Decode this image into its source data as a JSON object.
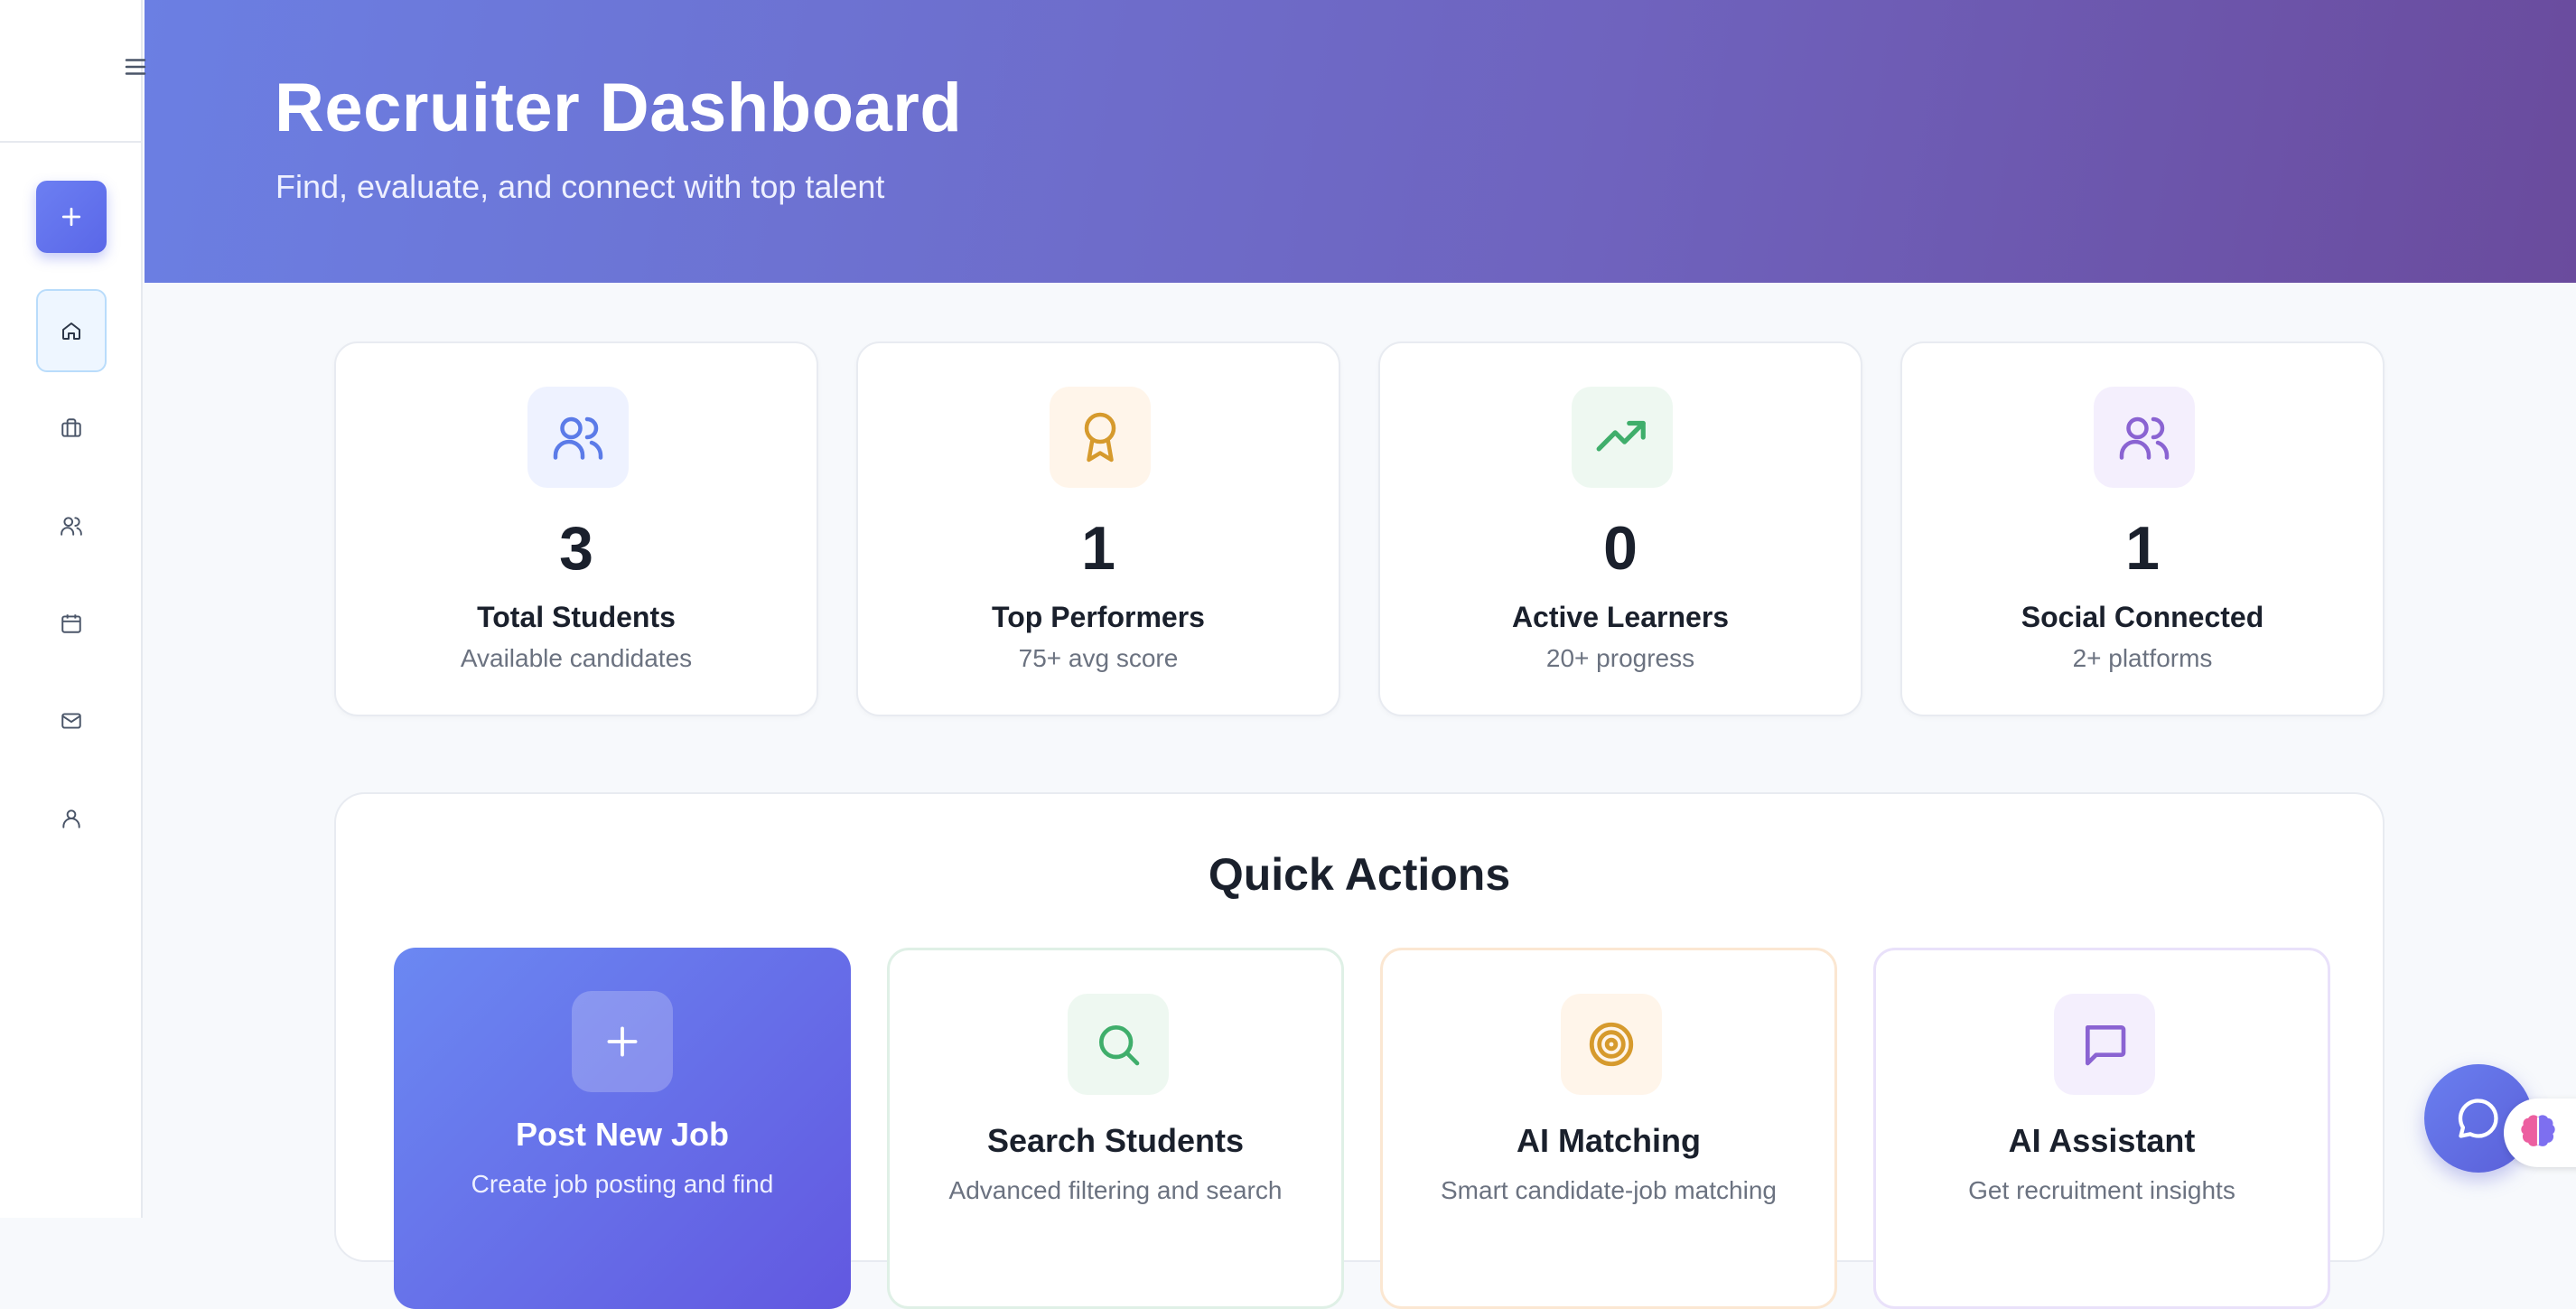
{
  "header": {
    "title": "Recruiter Dashboard",
    "subtitle": "Find, evaluate, and connect with top talent"
  },
  "sidebar": {
    "items": [
      {
        "icon": "home-icon",
        "active": true
      },
      {
        "icon": "briefcase-icon",
        "active": false
      },
      {
        "icon": "users-icon",
        "active": false
      },
      {
        "icon": "calendar-icon",
        "active": false
      },
      {
        "icon": "mail-icon",
        "active": false
      },
      {
        "icon": "user-icon",
        "active": false
      }
    ]
  },
  "stats": [
    {
      "value": "3",
      "title": "Total Students",
      "subtitle": "Available candidates",
      "icon": "users-icon",
      "color": "#5b7be8",
      "bg": "#eef2ff"
    },
    {
      "value": "1",
      "title": "Top Performers",
      "subtitle": "75+ avg score",
      "icon": "award-icon",
      "color": "#d69a2d",
      "bg": "#fff5ea"
    },
    {
      "value": "0",
      "title": "Active Learners",
      "subtitle": "20+ progress",
      "icon": "trending-up-icon",
      "color": "#3fae6b",
      "bg": "#eef8f1"
    },
    {
      "value": "1",
      "title": "Social Connected",
      "subtitle": "2+ platforms",
      "icon": "users-icon",
      "color": "#8a63d2",
      "bg": "#f4effd"
    }
  ],
  "quick_actions": {
    "title": "Quick Actions",
    "items": [
      {
        "name": "Post New Job",
        "description": "Create job posting and find",
        "icon": "plus-icon"
      },
      {
        "name": "Search Students",
        "description": "Advanced filtering and search",
        "icon": "search-icon",
        "color": "#3fae6b",
        "border": "#dff0e6"
      },
      {
        "name": "AI Matching",
        "description": "Smart candidate-job matching",
        "icon": "target-icon",
        "color": "#d69a2d",
        "border": "#fbe7d2"
      },
      {
        "name": "AI Assistant",
        "description": "Get recruitment insights",
        "icon": "message-square-icon",
        "color": "#8a63d2",
        "border": "#e9e1fa"
      }
    ]
  }
}
